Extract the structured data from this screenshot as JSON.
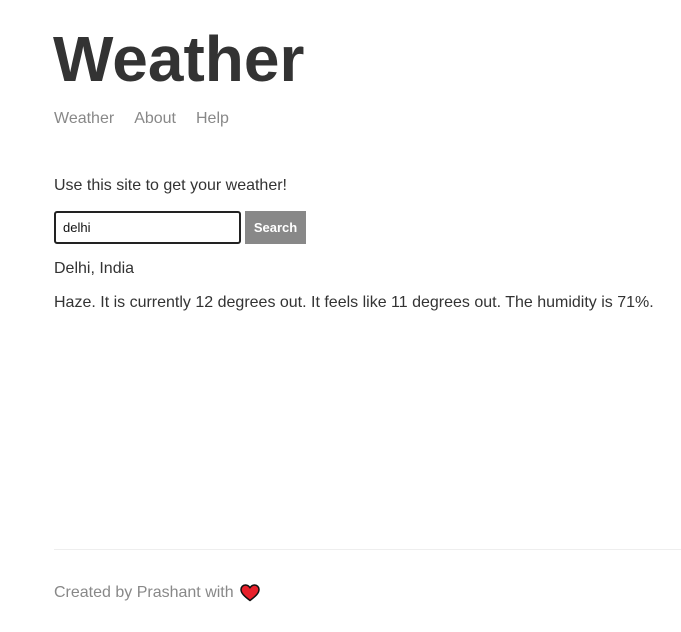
{
  "header": {
    "title": "Weather",
    "nav": {
      "weather": "Weather",
      "about": "About",
      "help": "Help"
    }
  },
  "main": {
    "intro": "Use this site to get your weather!",
    "search": {
      "value": "delhi",
      "placeholder": "",
      "button_label": "Search"
    },
    "result": {
      "location": "Delhi, India",
      "forecast": "Haze. It is currently 12 degrees out. It feels like 11 degrees out. The humidity is 71%."
    }
  },
  "footer": {
    "text": "Created by Prashant with",
    "icon": "heart-icon",
    "icon_color": "#e8212b"
  }
}
